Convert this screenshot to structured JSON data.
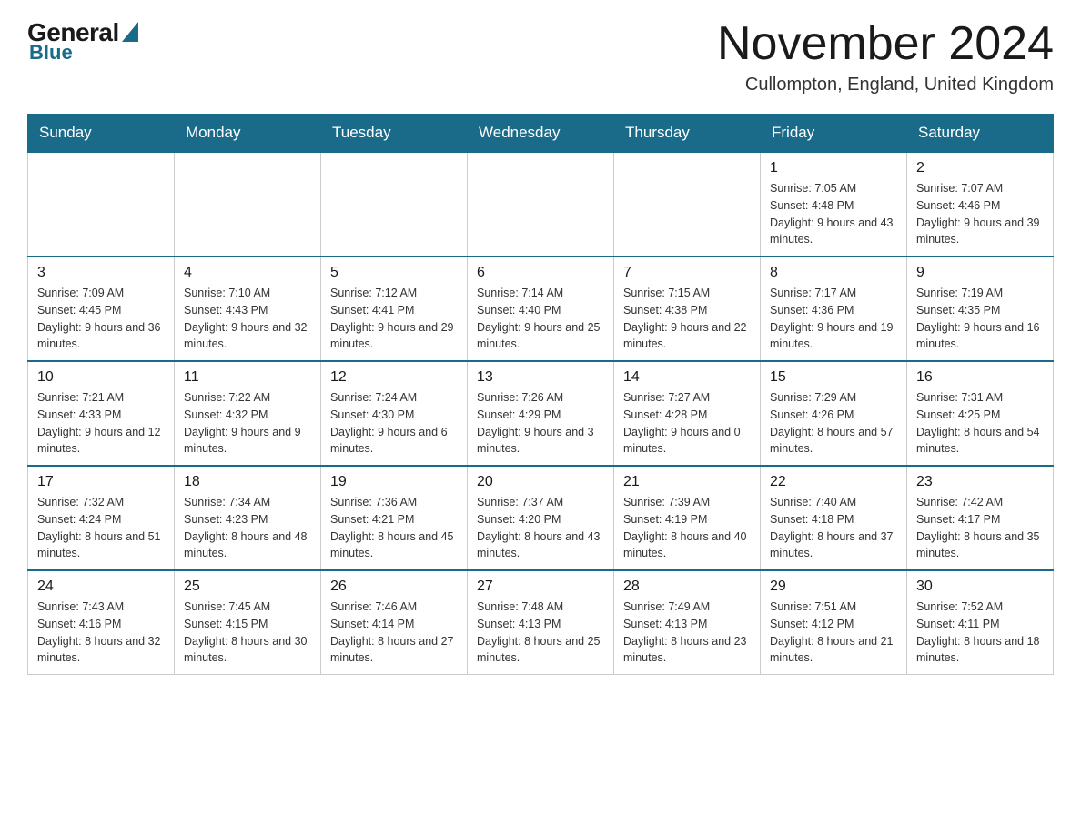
{
  "header": {
    "logo": {
      "general": "General",
      "blue": "Blue"
    },
    "title": "November 2024",
    "location": "Cullompton, England, United Kingdom"
  },
  "calendar": {
    "days_of_week": [
      "Sunday",
      "Monday",
      "Tuesday",
      "Wednesday",
      "Thursday",
      "Friday",
      "Saturday"
    ],
    "weeks": [
      [
        {
          "day": "",
          "info": "",
          "empty": true
        },
        {
          "day": "",
          "info": "",
          "empty": true
        },
        {
          "day": "",
          "info": "",
          "empty": true
        },
        {
          "day": "",
          "info": "",
          "empty": true
        },
        {
          "day": "",
          "info": "",
          "empty": true
        },
        {
          "day": "1",
          "info": "Sunrise: 7:05 AM\nSunset: 4:48 PM\nDaylight: 9 hours and 43 minutes.",
          "empty": false
        },
        {
          "day": "2",
          "info": "Sunrise: 7:07 AM\nSunset: 4:46 PM\nDaylight: 9 hours and 39 minutes.",
          "empty": false
        }
      ],
      [
        {
          "day": "3",
          "info": "Sunrise: 7:09 AM\nSunset: 4:45 PM\nDaylight: 9 hours and 36 minutes.",
          "empty": false
        },
        {
          "day": "4",
          "info": "Sunrise: 7:10 AM\nSunset: 4:43 PM\nDaylight: 9 hours and 32 minutes.",
          "empty": false
        },
        {
          "day": "5",
          "info": "Sunrise: 7:12 AM\nSunset: 4:41 PM\nDaylight: 9 hours and 29 minutes.",
          "empty": false
        },
        {
          "day": "6",
          "info": "Sunrise: 7:14 AM\nSunset: 4:40 PM\nDaylight: 9 hours and 25 minutes.",
          "empty": false
        },
        {
          "day": "7",
          "info": "Sunrise: 7:15 AM\nSunset: 4:38 PM\nDaylight: 9 hours and 22 minutes.",
          "empty": false
        },
        {
          "day": "8",
          "info": "Sunrise: 7:17 AM\nSunset: 4:36 PM\nDaylight: 9 hours and 19 minutes.",
          "empty": false
        },
        {
          "day": "9",
          "info": "Sunrise: 7:19 AM\nSunset: 4:35 PM\nDaylight: 9 hours and 16 minutes.",
          "empty": false
        }
      ],
      [
        {
          "day": "10",
          "info": "Sunrise: 7:21 AM\nSunset: 4:33 PM\nDaylight: 9 hours and 12 minutes.",
          "empty": false
        },
        {
          "day": "11",
          "info": "Sunrise: 7:22 AM\nSunset: 4:32 PM\nDaylight: 9 hours and 9 minutes.",
          "empty": false
        },
        {
          "day": "12",
          "info": "Sunrise: 7:24 AM\nSunset: 4:30 PM\nDaylight: 9 hours and 6 minutes.",
          "empty": false
        },
        {
          "day": "13",
          "info": "Sunrise: 7:26 AM\nSunset: 4:29 PM\nDaylight: 9 hours and 3 minutes.",
          "empty": false
        },
        {
          "day": "14",
          "info": "Sunrise: 7:27 AM\nSunset: 4:28 PM\nDaylight: 9 hours and 0 minutes.",
          "empty": false
        },
        {
          "day": "15",
          "info": "Sunrise: 7:29 AM\nSunset: 4:26 PM\nDaylight: 8 hours and 57 minutes.",
          "empty": false
        },
        {
          "day": "16",
          "info": "Sunrise: 7:31 AM\nSunset: 4:25 PM\nDaylight: 8 hours and 54 minutes.",
          "empty": false
        }
      ],
      [
        {
          "day": "17",
          "info": "Sunrise: 7:32 AM\nSunset: 4:24 PM\nDaylight: 8 hours and 51 minutes.",
          "empty": false
        },
        {
          "day": "18",
          "info": "Sunrise: 7:34 AM\nSunset: 4:23 PM\nDaylight: 8 hours and 48 minutes.",
          "empty": false
        },
        {
          "day": "19",
          "info": "Sunrise: 7:36 AM\nSunset: 4:21 PM\nDaylight: 8 hours and 45 minutes.",
          "empty": false
        },
        {
          "day": "20",
          "info": "Sunrise: 7:37 AM\nSunset: 4:20 PM\nDaylight: 8 hours and 43 minutes.",
          "empty": false
        },
        {
          "day": "21",
          "info": "Sunrise: 7:39 AM\nSunset: 4:19 PM\nDaylight: 8 hours and 40 minutes.",
          "empty": false
        },
        {
          "day": "22",
          "info": "Sunrise: 7:40 AM\nSunset: 4:18 PM\nDaylight: 8 hours and 37 minutes.",
          "empty": false
        },
        {
          "day": "23",
          "info": "Sunrise: 7:42 AM\nSunset: 4:17 PM\nDaylight: 8 hours and 35 minutes.",
          "empty": false
        }
      ],
      [
        {
          "day": "24",
          "info": "Sunrise: 7:43 AM\nSunset: 4:16 PM\nDaylight: 8 hours and 32 minutes.",
          "empty": false
        },
        {
          "day": "25",
          "info": "Sunrise: 7:45 AM\nSunset: 4:15 PM\nDaylight: 8 hours and 30 minutes.",
          "empty": false
        },
        {
          "day": "26",
          "info": "Sunrise: 7:46 AM\nSunset: 4:14 PM\nDaylight: 8 hours and 27 minutes.",
          "empty": false
        },
        {
          "day": "27",
          "info": "Sunrise: 7:48 AM\nSunset: 4:13 PM\nDaylight: 8 hours and 25 minutes.",
          "empty": false
        },
        {
          "day": "28",
          "info": "Sunrise: 7:49 AM\nSunset: 4:13 PM\nDaylight: 8 hours and 23 minutes.",
          "empty": false
        },
        {
          "day": "29",
          "info": "Sunrise: 7:51 AM\nSunset: 4:12 PM\nDaylight: 8 hours and 21 minutes.",
          "empty": false
        },
        {
          "day": "30",
          "info": "Sunrise: 7:52 AM\nSunset: 4:11 PM\nDaylight: 8 hours and 18 minutes.",
          "empty": false
        }
      ]
    ]
  }
}
